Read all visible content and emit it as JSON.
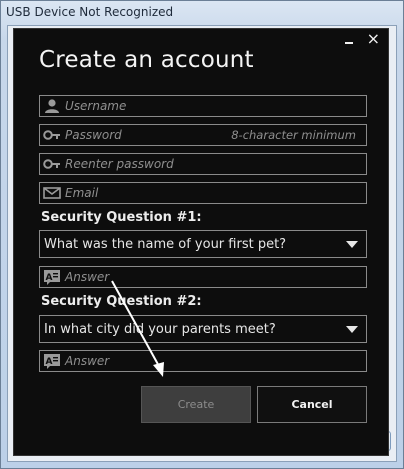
{
  "window": {
    "title": "USB Device Not Recognized"
  },
  "dialog": {
    "heading": "Create an account",
    "controls": {
      "minimize_icon": "minimize-icon",
      "close_glyph": "×"
    },
    "fields": {
      "username": {
        "placeholder": "Username",
        "icon": "user-icon"
      },
      "password": {
        "placeholder": "Password",
        "hint": "8-character minimum",
        "icon": "key-icon"
      },
      "reenter_password": {
        "placeholder": "Reenter password",
        "icon": "key-icon"
      },
      "email": {
        "placeholder": "Email",
        "icon": "envelope-icon"
      }
    },
    "security_question_1": {
      "label": "Security Question #1:",
      "selected": "What was the name of your first pet?",
      "answer_placeholder": "Answer",
      "answer_icon": "text-answer-icon"
    },
    "security_question_2": {
      "label": "Security Question #2:",
      "selected": "In what city did your parents meet?",
      "answer_placeholder": "Answer",
      "answer_icon": "text-answer-icon"
    },
    "buttons": {
      "create": "Create",
      "cancel": "Cancel"
    }
  },
  "colors": {
    "dialog_bg": "#0d0d0d",
    "field_border": "#8a8a8a",
    "placeholder": "#8f8f8f",
    "annotation_arrow": "#ffffff"
  }
}
